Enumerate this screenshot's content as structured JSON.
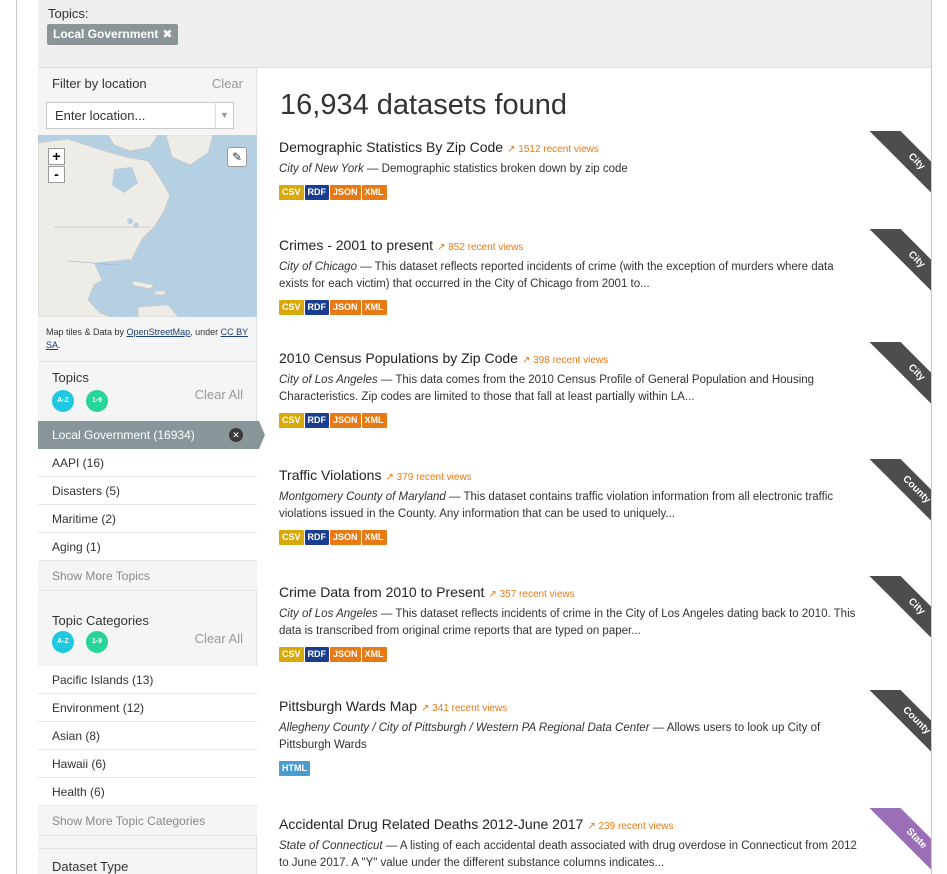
{
  "topbar": {
    "label": "Topics:",
    "active_filter": "Local Government",
    "remove_icon": "close-icon"
  },
  "sidebar": {
    "location": {
      "title": "Filter by location",
      "clear": "Clear",
      "placeholder": "Enter location...",
      "map_attribution_pre": "Map tiles & Data by ",
      "map_attribution_link1": "OpenStreetMap",
      "map_attribution_mid": ", under ",
      "map_attribution_link2": "CC BY SA",
      "map_attribution_post": "."
    },
    "topics": {
      "title": "Topics",
      "clear": "Clear All",
      "sort_az": "A-Z",
      "sort_19": "1-9",
      "active": "Local Government (16934)",
      "items": [
        "AAPI (16)",
        "Disasters (5)",
        "Maritime (2)",
        "Aging (1)"
      ],
      "more": "Show More Topics"
    },
    "categories": {
      "title": "Topic Categories",
      "clear": "Clear All",
      "sort_az": "A-Z",
      "sort_19": "1-9",
      "items": [
        "Pacific Islands (13)",
        "Environment (12)",
        "Asian (8)",
        "Hawaii (6)",
        "Health (6)"
      ],
      "more": "Show More Topic Categories"
    },
    "dataset_type": {
      "title": "Dataset Type"
    }
  },
  "main": {
    "results_title": "16,934 datasets found",
    "datasets": [
      {
        "title": "Demographic Statistics By Zip Code",
        "views": "1512 recent views",
        "publisher": "City of New York",
        "desc": " — Demographic statistics broken down by zip code",
        "formats": [
          "CSV",
          "RDF",
          "JSON",
          "XML"
        ],
        "ribbon": "City",
        "ribbon_color": "#4d4d4d"
      },
      {
        "title": "Crimes - 2001 to present",
        "views": "852 recent views",
        "publisher": "City of Chicago",
        "desc": " — This dataset reflects reported incidents of crime (with the exception of murders where data exists for each victim) that occurred in the City of Chicago from 2001 to...",
        "formats": [
          "CSV",
          "RDF",
          "JSON",
          "XML"
        ],
        "ribbon": "City",
        "ribbon_color": "#4d4d4d"
      },
      {
        "title": "2010 Census Populations by Zip Code",
        "views": "398 recent views",
        "publisher": "City of Los Angeles",
        "desc": " — This data comes from the 2010 Census Profile of General Population and Housing Characteristics. Zip codes are limited to those that fall at least partially within LA...",
        "formats": [
          "CSV",
          "RDF",
          "JSON",
          "XML"
        ],
        "ribbon": "City",
        "ribbon_color": "#4d4d4d"
      },
      {
        "title": "Traffic Violations",
        "views": "379 recent views",
        "publisher": "Montgomery County of Maryland",
        "desc": " — This dataset contains traffic violation information from all electronic traffic violations issued in the County. Any information that can be used to uniquely...",
        "formats": [
          "CSV",
          "RDF",
          "JSON",
          "XML"
        ],
        "ribbon": "County",
        "ribbon_color": "#4d4d4d"
      },
      {
        "title": "Crime Data from 2010 to Present",
        "views": "357 recent views",
        "publisher": "City of Los Angeles",
        "desc": " — This dataset reflects incidents of crime in the City of Los Angeles dating back to 2010. This data is transcribed from original crime reports that are typed on paper...",
        "formats": [
          "CSV",
          "RDF",
          "JSON",
          "XML"
        ],
        "ribbon": "City",
        "ribbon_color": "#4d4d4d"
      },
      {
        "title": "Pittsburgh Wards Map",
        "views": "341 recent views",
        "publisher": "Allegheny County / City of Pittsburgh / Western PA Regional Data Center",
        "desc": " — Allows users to look up City of Pittsburgh Wards",
        "formats": [
          "HTML"
        ],
        "ribbon": "County",
        "ribbon_color": "#4d4d4d"
      },
      {
        "title": "Accidental Drug Related Deaths 2012-June 2017",
        "views": "239 recent views",
        "publisher": "State of Connecticut",
        "desc": " — A listing of each accidental death associated with drug overdose in Connecticut from 2012 to June 2017. A \"Y\" value under the different substance columns indicates...",
        "formats": [],
        "ribbon": "State",
        "ribbon_color": "#9b6fb5"
      }
    ]
  }
}
